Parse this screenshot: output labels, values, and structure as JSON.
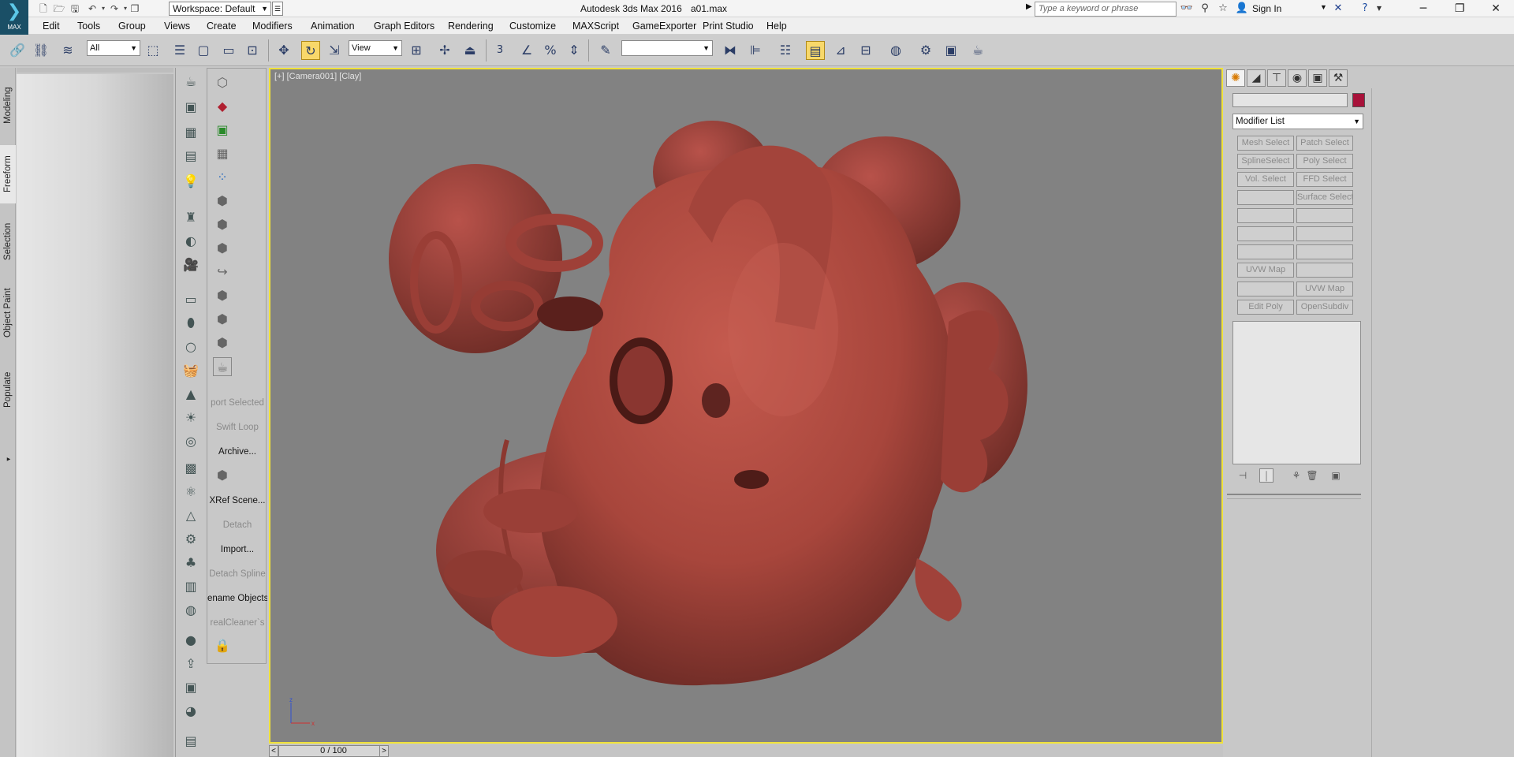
{
  "window": {
    "app_title": "Autodesk 3ds Max 2016",
    "doc_title": "a01.max",
    "logo_label": "MAX",
    "workspace": "Workspace: Default",
    "search_placeholder": "Type a keyword or phrase",
    "sign_in": "Sign In"
  },
  "menu": [
    "Edit",
    "Tools",
    "Group",
    "Views",
    "Create",
    "Modifiers",
    "Animation",
    "Graph Editors",
    "Rendering",
    "Customize",
    "MAXScript",
    "GameExporter",
    "Print Studio",
    "Help"
  ],
  "toolbar": {
    "selection_filter": "All",
    "ref_coord": "View",
    "snap_label": "3",
    "named_selection": ""
  },
  "ribbon_tabs": [
    "Modeling",
    "Freeform",
    "Selection",
    "Object Paint",
    "Populate"
  ],
  "ribbon_active_tab": "Freeform",
  "command_panel_col2_labels": [
    {
      "text": "port Selected",
      "dim": true
    },
    {
      "text": "Swift Loop",
      "dim": true
    },
    {
      "text": "Archive...",
      "dim": false
    },
    {
      "text": "XRef Scene...",
      "dim": false
    },
    {
      "text": "Detach",
      "dim": true
    },
    {
      "text": "Import...",
      "dim": false
    },
    {
      "text": "Detach Spline",
      "dim": true
    },
    {
      "text": "ename Objects",
      "dim": false
    },
    {
      "text": "realCleaner`s",
      "dim": true
    }
  ],
  "viewport": {
    "label": "[+] [Camera001] [Clay]",
    "axis_x": "x",
    "axis_z": "z",
    "object_color": "#a8463c"
  },
  "timeline": {
    "frame_display": "0 / 100",
    "prev": "<",
    "next": ">"
  },
  "command_panel": {
    "object_color": "#a8123a",
    "modifier_list_label": "Modifier List",
    "modifier_buttons": [
      [
        "Mesh Select",
        "Patch Select"
      ],
      [
        "SplineSelect",
        "Poly Select"
      ],
      [
        "Vol. Select",
        "FFD Select"
      ],
      [
        "",
        "Surface Select"
      ],
      [
        "",
        ""
      ],
      [
        "",
        ""
      ],
      [
        "",
        ""
      ],
      [
        "UVW Map",
        ""
      ],
      [
        "",
        "UVW Map"
      ],
      [
        "Edit Poly",
        "OpenSubdiv"
      ]
    ]
  }
}
